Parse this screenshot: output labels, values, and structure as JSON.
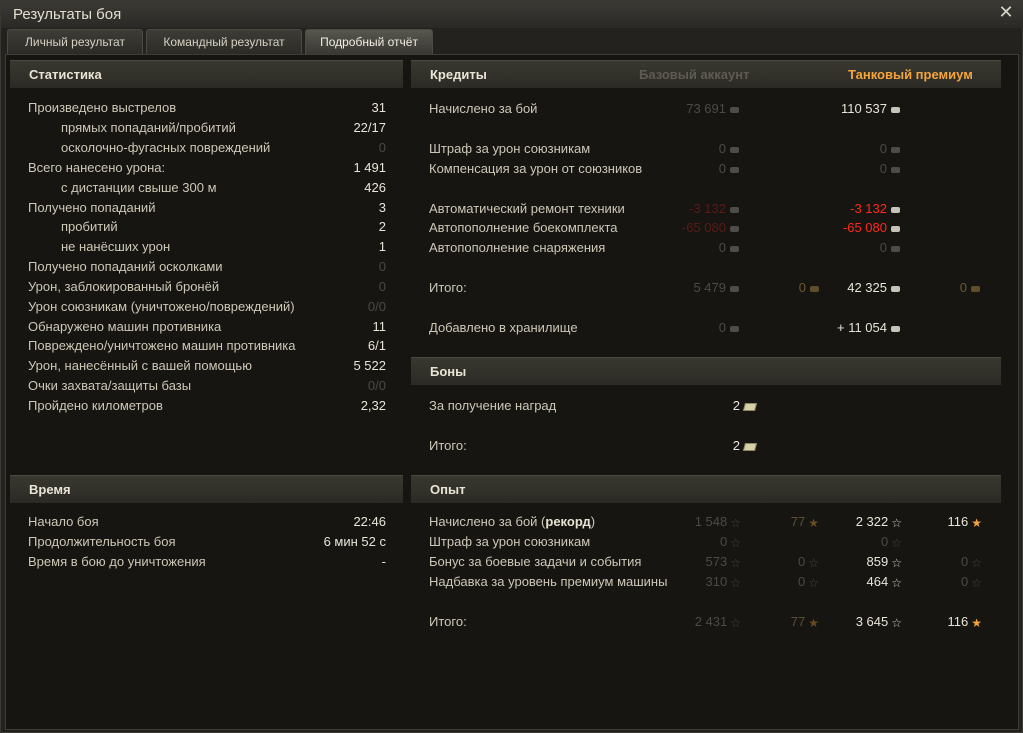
{
  "window": {
    "title": "Результаты боя"
  },
  "tabs": [
    {
      "label": "Личный результат"
    },
    {
      "label": "Командный результат"
    },
    {
      "label": "Подробный отчёт"
    }
  ],
  "stats": {
    "title": "Статистика",
    "rows": [
      {
        "label": "Произведено выстрелов",
        "value": "31"
      },
      {
        "label": "прямых попаданий/пробитий",
        "value": "22/17"
      },
      {
        "label": "осколочно-фугасных повреждений",
        "value": "0"
      },
      {
        "label": "Всего нанесено урона:",
        "value": "1 491"
      },
      {
        "label": "с дистанции свыше 300 м",
        "value": "426"
      },
      {
        "label": "Получено попаданий",
        "value": "3"
      },
      {
        "label": "пробитий",
        "value": "2"
      },
      {
        "label": "не нанёсших урон",
        "value": "1"
      },
      {
        "label": "Получено попаданий осколками",
        "value": "0"
      },
      {
        "label": "Урон, заблокированный бронёй",
        "value": "0"
      },
      {
        "label": "Урон союзникам (уничтожено/повреждений)",
        "value": "0/0"
      },
      {
        "label": "Обнаружено машин противника",
        "value": "11"
      },
      {
        "label": "Повреждено/уничтожено машин противника",
        "value": "6/1"
      },
      {
        "label": "Урон, нанесённый с вашей помощью",
        "value": "5 522"
      },
      {
        "label": "Очки захвата/защиты базы",
        "value": "0/0"
      },
      {
        "label": "Пройдено километров",
        "value": "2,32"
      }
    ]
  },
  "time": {
    "title": "Время",
    "rows": [
      {
        "label": "Начало боя",
        "value": "22:46"
      },
      {
        "label": "Продолжительность боя",
        "value": "6 мин 52 с"
      },
      {
        "label": "Время в бою до уничтожения",
        "value": "-"
      }
    ]
  },
  "credits": {
    "title": "Кредиты",
    "col_base": "Базовый аккаунт",
    "col_premium": "Танковый премиум",
    "rows": [
      {
        "label": "Начислено за бой",
        "base": "73 691",
        "premium": "110 537"
      },
      {
        "label": "Штраф за урон союзникам",
        "base": "0",
        "premium": "0"
      },
      {
        "label": "Компенсация за урон от союзников",
        "base": "0",
        "premium": "0"
      },
      {
        "label": "Автоматический ремонт техники",
        "base": "-3 132",
        "premium": "-3 132"
      },
      {
        "label": "Автопополнение боекомплекта",
        "base": "-65 080",
        "premium": "-65 080"
      },
      {
        "label": "Автопополнение снаряжения",
        "base": "0",
        "premium": "0"
      },
      {
        "label": "Итого:",
        "base": "5 479",
        "base_gold": "0",
        "premium": "42 325",
        "premium_gold": "0"
      },
      {
        "label": "Добавлено в хранилище",
        "base": "0",
        "premium": "+ 11 054"
      }
    ]
  },
  "bonds": {
    "title": "Боны",
    "rows": [
      {
        "label": "За получение наград",
        "value": "2"
      },
      {
        "label": "Итого:",
        "value": "2"
      }
    ]
  },
  "xp": {
    "title": "Опыт",
    "rows": [
      {
        "label": "Начислено за бой (",
        "label_bold": "рекорд",
        "label_end": ")",
        "base": "1 548",
        "base_free": "77",
        "premium": "2 322",
        "premium_free": "116"
      },
      {
        "label": "Штраф за урон союзникам",
        "base": "0",
        "premium": "0"
      },
      {
        "label": "Бонус за боевые задачи и события",
        "base": "573",
        "base_free": "0",
        "premium": "859",
        "premium_free": "0"
      },
      {
        "label": "Надбавка за уровень премиум машины",
        "base": "310",
        "base_free": "0",
        "premium": "464",
        "premium_free": "0"
      },
      {
        "label": "Итого:",
        "base": "2 431",
        "base_free": "77",
        "premium": "3 645",
        "premium_free": "116"
      }
    ]
  },
  "colors": {
    "accent": "#f5a43c",
    "negative": "#ff2a1a"
  }
}
